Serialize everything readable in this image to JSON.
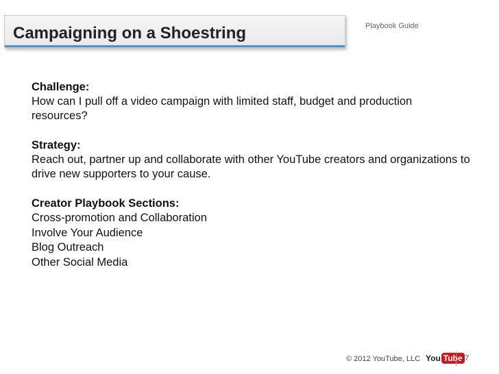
{
  "header": {
    "title": "Campaigning on a Shoestring",
    "guide_label": "Playbook Guide"
  },
  "challenge": {
    "heading": "Challenge:",
    "text": "How can I pull off a video campaign with limited staff, budget and production resources?"
  },
  "strategy": {
    "heading": "Strategy:",
    "text": "Reach out, partner up and collaborate with other YouTube creators and organizations to drive new supporters to your cause."
  },
  "sections": {
    "heading": "Creator Playbook Sections:",
    "items": [
      "Cross-promotion and Collaboration",
      "Involve Your Audience",
      "Blog Outreach",
      "Other Social Media"
    ]
  },
  "footer": {
    "copyright": "© 2012 YouTube, LLC",
    "logo_you": "You",
    "logo_tube": "Tube",
    "page_number": "17"
  },
  "colors": {
    "accent_bar": "#4a8fd4",
    "youtube_red": "#cc181e"
  }
}
